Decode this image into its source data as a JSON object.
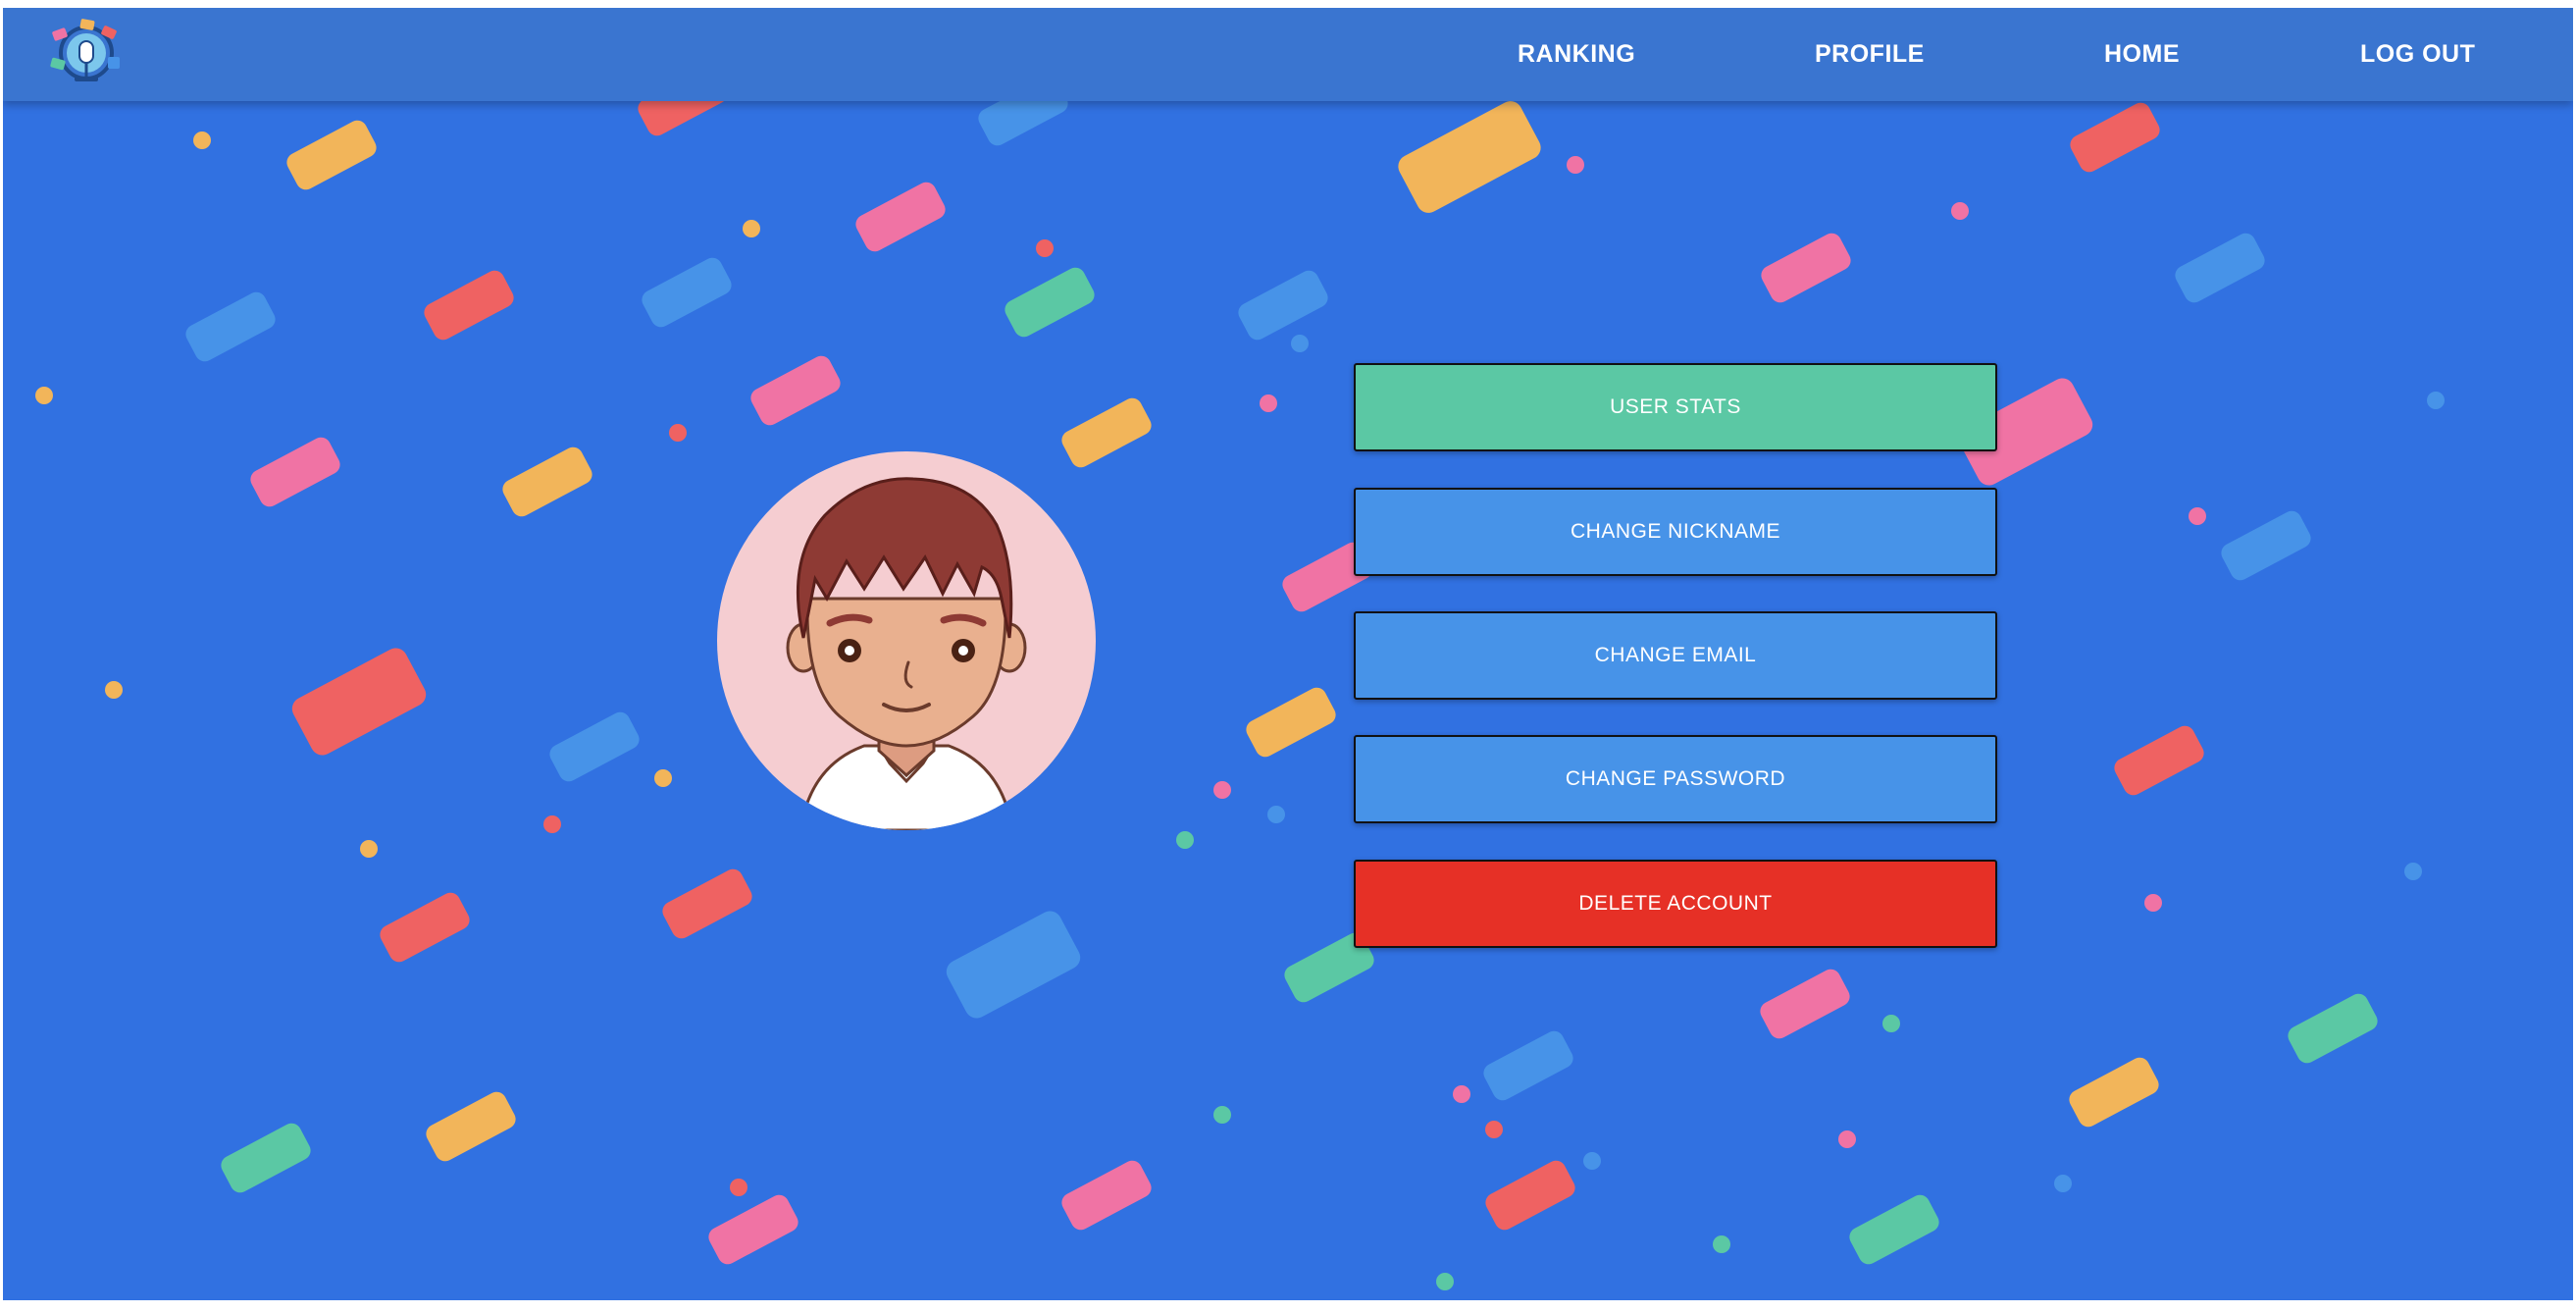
{
  "nav": {
    "logo_icon": "globe-microphone-logo-icon",
    "links": [
      {
        "label": "RANKING"
      },
      {
        "label": "PROFILE"
      },
      {
        "label": "HOME"
      },
      {
        "label": "LOG OUT"
      }
    ]
  },
  "profile": {
    "avatar_icon": "boy-avatar-illustration",
    "actions": [
      {
        "label": "USER STATS",
        "color": "#5bc8a4"
      },
      {
        "label": "CHANGE NICKNAME",
        "color": "#4793e8"
      },
      {
        "label": "CHANGE EMAIL",
        "color": "#4793e8"
      },
      {
        "label": "CHANGE PASSWORD",
        "color": "#4793e8"
      },
      {
        "label": "DELETE ACCOUNT",
        "color": "#e63026"
      }
    ]
  },
  "theme": {
    "background": "#3171e1",
    "navbar": "#3a75d0",
    "confetti_colors": [
      "#f2b55a",
      "#ef6262",
      "#f073a4",
      "#5bc8a4",
      "#4793e8"
    ]
  }
}
